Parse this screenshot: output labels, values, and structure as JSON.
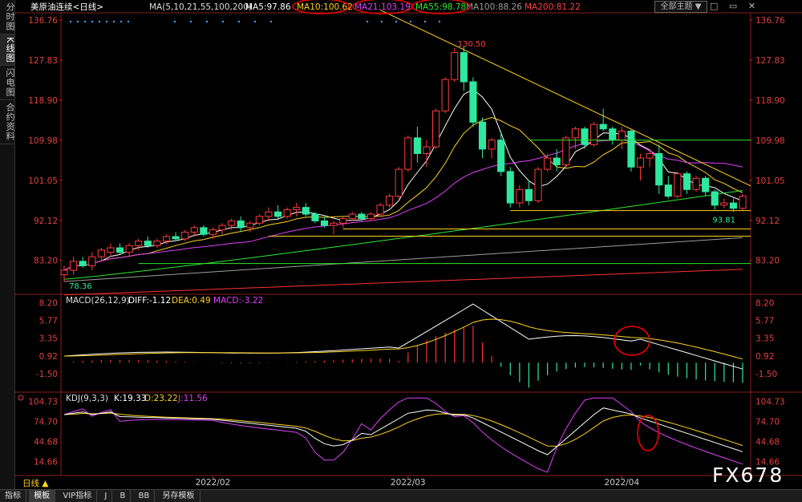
{
  "sidebar": {
    "tabs": [
      "分时图",
      "K线图",
      "闪电图",
      "合约资料"
    ]
  },
  "bottom_tabs": [
    "指标",
    "模板",
    "VIP指标",
    "J",
    "B",
    "BB",
    "另存模板"
  ],
  "period": "日线 ▲",
  "theme_button": "全部主题 ▼",
  "top_icons": {
    "minimize": "□",
    "restore": "▭",
    "close": "✕"
  },
  "watermark": "FX678",
  "chart_data": {
    "type": "candlestick",
    "title": "美原油连续<日线>",
    "main": {
      "y_ticks": [
        "136.76",
        "127.83",
        "118.90",
        "109.98",
        "101.05",
        "92.12",
        "83.20"
      ],
      "ylim": [
        76,
        138
      ],
      "legend": "MA(5,10,21,55,100,200)",
      "ma": [
        {
          "label": "MA5:97.86",
          "color": "#ffffff"
        },
        {
          "label": "MA10:100.62",
          "color": "#ffd21e"
        },
        {
          "label": "MA21:103.19",
          "color": "#e040fb"
        },
        {
          "label": "MA55:98.78",
          "color": "#2ee82e"
        },
        {
          "label": "MA100:88.26",
          "color": "#9e9e9e"
        },
        {
          "label": "MA200:81.22",
          "color": "#ff3030"
        }
      ],
      "annotations": {
        "high": "130.50",
        "low_start": "78.36",
        "low_end": "93.81"
      },
      "ohlc": [
        [
          80,
          82,
          78.4,
          81
        ],
        [
          81,
          84,
          80,
          83
        ],
        [
          83,
          84,
          81.5,
          82
        ],
        [
          82,
          85,
          81,
          84
        ],
        [
          84,
          86,
          83,
          85.5
        ],
        [
          85,
          87,
          84,
          86
        ],
        [
          86,
          87,
          84.5,
          85
        ],
        [
          85,
          87,
          84,
          86.5
        ],
        [
          86.5,
          88,
          85.5,
          87.5
        ],
        [
          87.5,
          88.5,
          86,
          86.5
        ],
        [
          86.5,
          88,
          86,
          87.5
        ],
        [
          87.5,
          89,
          86.8,
          88.5
        ],
        [
          88.5,
          89.5,
          87.5,
          88
        ],
        [
          88,
          90,
          87.5,
          89.5
        ],
        [
          89.5,
          91,
          88.5,
          90.5
        ],
        [
          90.5,
          91,
          88.5,
          89
        ],
        [
          89,
          90.5,
          88,
          90
        ],
        [
          90,
          91.5,
          89,
          91
        ],
        [
          91,
          92.5,
          90,
          92
        ],
        [
          92,
          93,
          89.5,
          90.5
        ],
        [
          90.5,
          92,
          89.5,
          91.5
        ],
        [
          91.5,
          93.5,
          91,
          93
        ],
        [
          93,
          95,
          92,
          94
        ],
        [
          94,
          95.5,
          92.5,
          93
        ],
        [
          93,
          95,
          92.5,
          94.5
        ],
        [
          94.5,
          96,
          93,
          95
        ],
        [
          95,
          96,
          93,
          93.5
        ],
        [
          93.5,
          94,
          91.5,
          92
        ],
        [
          92,
          93,
          90.5,
          91
        ],
        [
          91,
          92,
          89,
          91.5
        ],
        [
          91.5,
          93,
          90.5,
          92.5
        ],
        [
          92.5,
          94,
          92,
          93.5
        ],
        [
          93.5,
          94,
          92,
          92.5
        ],
        [
          92.5,
          94,
          92,
          93.5
        ],
        [
          93.5,
          96,
          93,
          95.5
        ],
        [
          95.5,
          98,
          95,
          97.5
        ],
        [
          97.5,
          104,
          97,
          103.5
        ],
        [
          103.5,
          111,
          103,
          110.5
        ],
        [
          110.5,
          113,
          105,
          107
        ],
        [
          107,
          110,
          104,
          108.5
        ],
        [
          108.5,
          117,
          108,
          116.5
        ],
        [
          116.5,
          124,
          116,
          123.5
        ],
        [
          123.5,
          130.5,
          123,
          129.5
        ],
        [
          129.5,
          131,
          121,
          123
        ],
        [
          123,
          124,
          113,
          114
        ],
        [
          114,
          115,
          106,
          108
        ],
        [
          108,
          110.5,
          106,
          110
        ],
        [
          110,
          112,
          102,
          103
        ],
        [
          103,
          104,
          95,
          96
        ],
        [
          96,
          100,
          95,
          99
        ],
        [
          99,
          101,
          95.5,
          96.5
        ],
        [
          96.5,
          104,
          96,
          103.5
        ],
        [
          103.5,
          107,
          103,
          106
        ],
        [
          106,
          108,
          103,
          104.5
        ],
        [
          104.5,
          111,
          104,
          110.5
        ],
        [
          110.5,
          113,
          108,
          112.5
        ],
        [
          112.5,
          113,
          108,
          109
        ],
        [
          109,
          114,
          108.5,
          113.5
        ],
        [
          113.5,
          117,
          112,
          112.5
        ],
        [
          112.5,
          113,
          109,
          110
        ],
        [
          110,
          113,
          108,
          112
        ],
        [
          112,
          112.5,
          103,
          104
        ],
        [
          104,
          107,
          101,
          106
        ],
        [
          106,
          108,
          104,
          107
        ],
        [
          107,
          109,
          98,
          100
        ],
        [
          100,
          102,
          97,
          97.5
        ],
        [
          97.5,
          103,
          97,
          102.5
        ],
        [
          102.5,
          103,
          98,
          99
        ],
        [
          99,
          102,
          98.5,
          101.5
        ],
        [
          101.5,
          102,
          97.5,
          98.5
        ],
        [
          98.5,
          99,
          94.5,
          95.5
        ],
        [
          95.5,
          97,
          94.8,
          96
        ],
        [
          96,
          97,
          94,
          94.8
        ],
        [
          94.8,
          98,
          94.2,
          97.5
        ]
      ]
    },
    "macd": {
      "label": "MACD(26,12,9)",
      "values": {
        "diff": "DIFF:-1.12",
        "dea": "DEA:0.49",
        "macd": "MACD:-3.22"
      },
      "y_ticks": [
        "8.20",
        "5.77",
        "3.35",
        "0.92",
        "-1.50"
      ],
      "ylim": [
        -3.8,
        9.0
      ]
    },
    "kdj": {
      "label": "KDJ(9,3,3)",
      "values": {
        "k": "K:19.33",
        "d": "D:23.22",
        "j": "J:11.56"
      },
      "y_ticks": [
        "104.73",
        "74.70",
        "44.68",
        "14.66"
      ],
      "ylim": [
        -5,
        115
      ]
    },
    "x_labels": [
      "2022/02",
      "2022/03",
      "2022/04"
    ],
    "x_label_index": [
      16,
      37,
      60
    ]
  }
}
